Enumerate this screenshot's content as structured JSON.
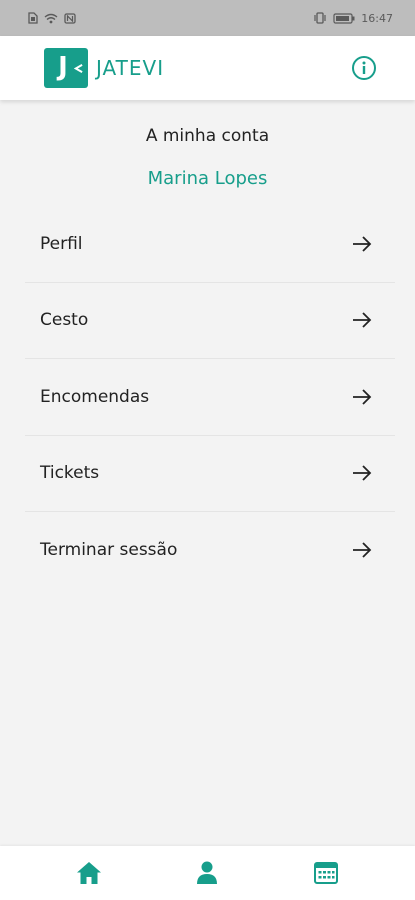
{
  "status_bar": {
    "time": "16:47",
    "left_icons": [
      "sim-icon",
      "wifi-icon",
      "nfc-icon"
    ],
    "right_icons": [
      "vibrate-icon",
      "battery-icon"
    ]
  },
  "header": {
    "logo_letter": "J",
    "brand_name": "JATEVI",
    "info_icon": "info-icon"
  },
  "account": {
    "title": "A minha conta",
    "user_name": "Marina Lopes"
  },
  "menu": {
    "items": [
      {
        "label": "Perfil"
      },
      {
        "label": "Cesto"
      },
      {
        "label": "Encomendas"
      },
      {
        "label": "Tickets"
      },
      {
        "label": "Terminar sessão"
      }
    ]
  },
  "bottom_nav": {
    "items": [
      "home-icon",
      "user-icon",
      "calendar-icon"
    ]
  },
  "colors": {
    "accent": "#179e8b",
    "background": "#f3f3f3",
    "status_bar": "#bdbdbd"
  }
}
